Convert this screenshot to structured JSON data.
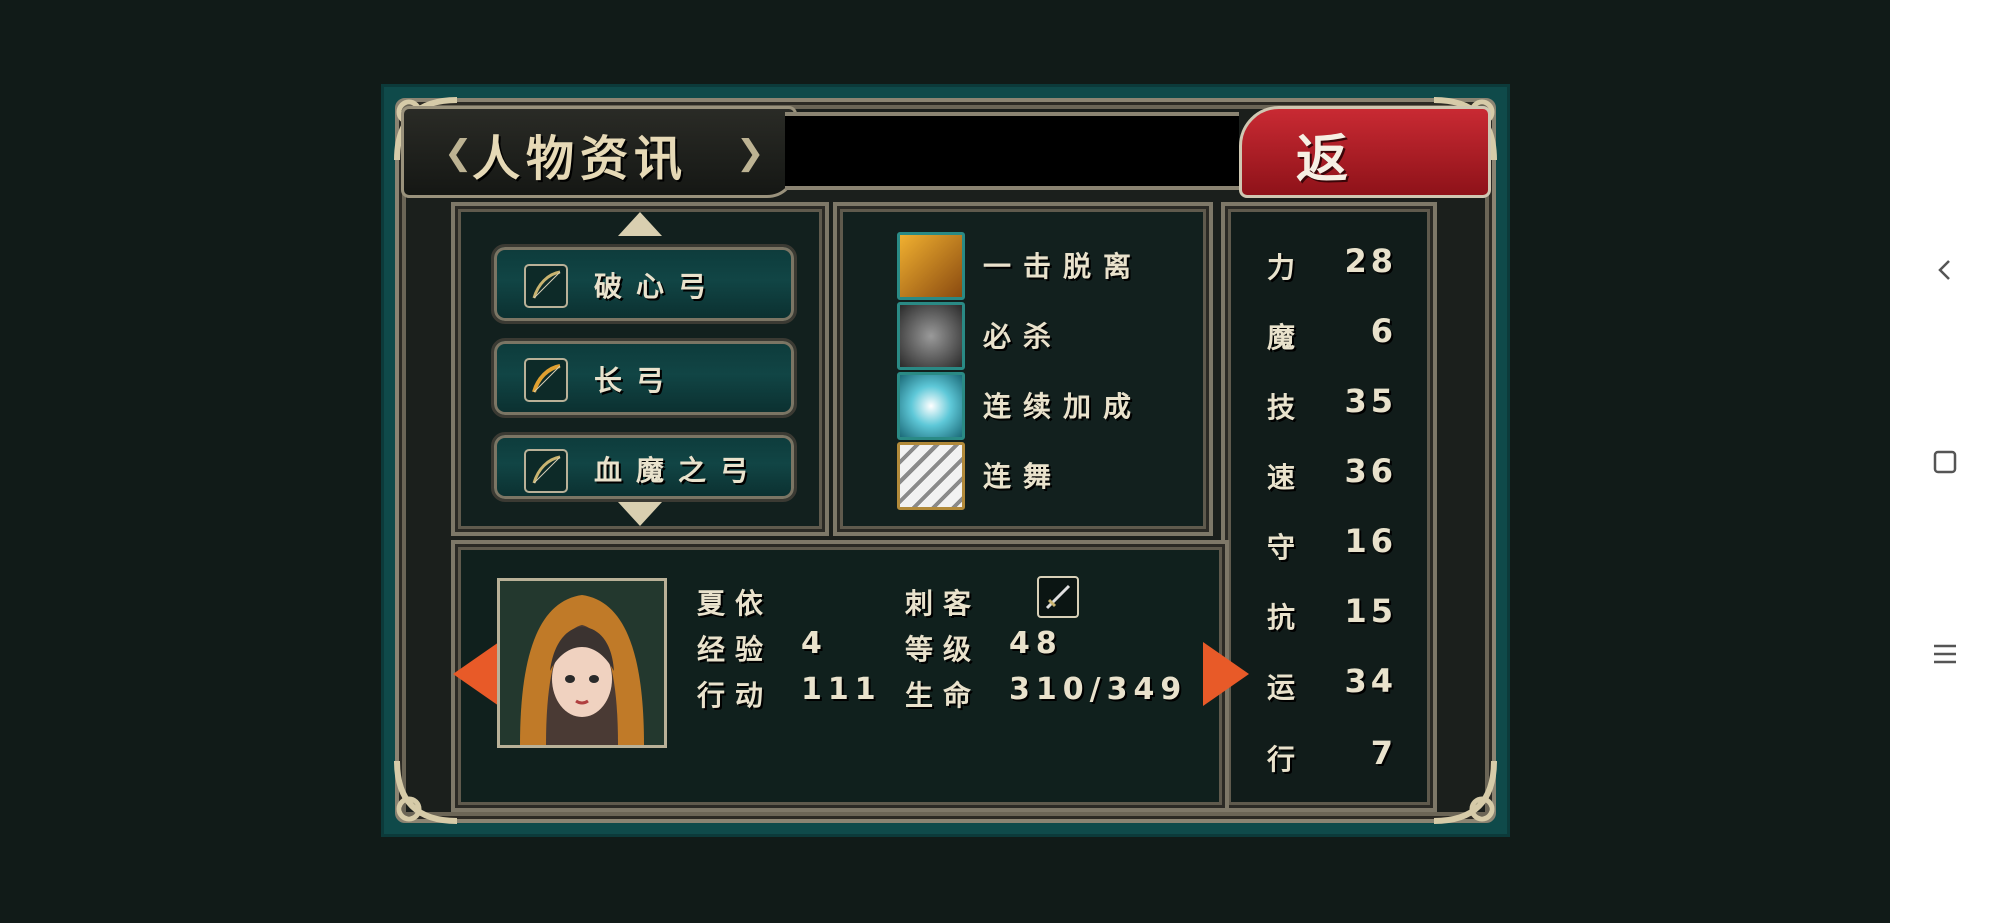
{
  "screen": {
    "title": "人物资讯",
    "back_label": "返 回"
  },
  "equipment": {
    "items": [
      {
        "label": "破心弓",
        "icon": "bow-icon"
      },
      {
        "label": "长弓",
        "icon": "bow-icon"
      },
      {
        "label": "血魔之弓",
        "icon": "bow-icon"
      }
    ]
  },
  "skills": {
    "items": [
      {
        "label": "一击脱离",
        "icon": "dragon-strike-icon"
      },
      {
        "label": "必杀",
        "icon": "demon-mask-icon"
      },
      {
        "label": "连续加成",
        "icon": "ice-burst-icon"
      },
      {
        "label": "连舞",
        "icon": "slash-icon"
      }
    ]
  },
  "stats": [
    {
      "name": "力",
      "value": "28"
    },
    {
      "name": "魔",
      "value": "6"
    },
    {
      "name": "技",
      "value": "35"
    },
    {
      "name": "速",
      "value": "36"
    },
    {
      "name": "守",
      "value": "16"
    },
    {
      "name": "抗",
      "value": "15"
    },
    {
      "name": "运",
      "value": "34"
    },
    {
      "name": "行",
      "value": "7"
    }
  ],
  "character": {
    "name": "夏依",
    "class": "刺客",
    "exp_label": "经验",
    "exp_value": "4",
    "level_label": "等级",
    "level_value": "48",
    "action_label": "行动",
    "action_value": "111",
    "hp_label": "生命",
    "hp_value": "310/349",
    "weapon_type_icon": "dagger-icon"
  },
  "system_nav": {
    "back_icon": "chevron-left-icon",
    "home_icon": "square-icon",
    "menu_icon": "menu-lines-icon"
  },
  "colors": {
    "teal_frame": "#0f4a4a",
    "back_button_red": "#b71e27",
    "arrow_orange": "#e85a28",
    "text_cream": "#e9e2cc"
  }
}
